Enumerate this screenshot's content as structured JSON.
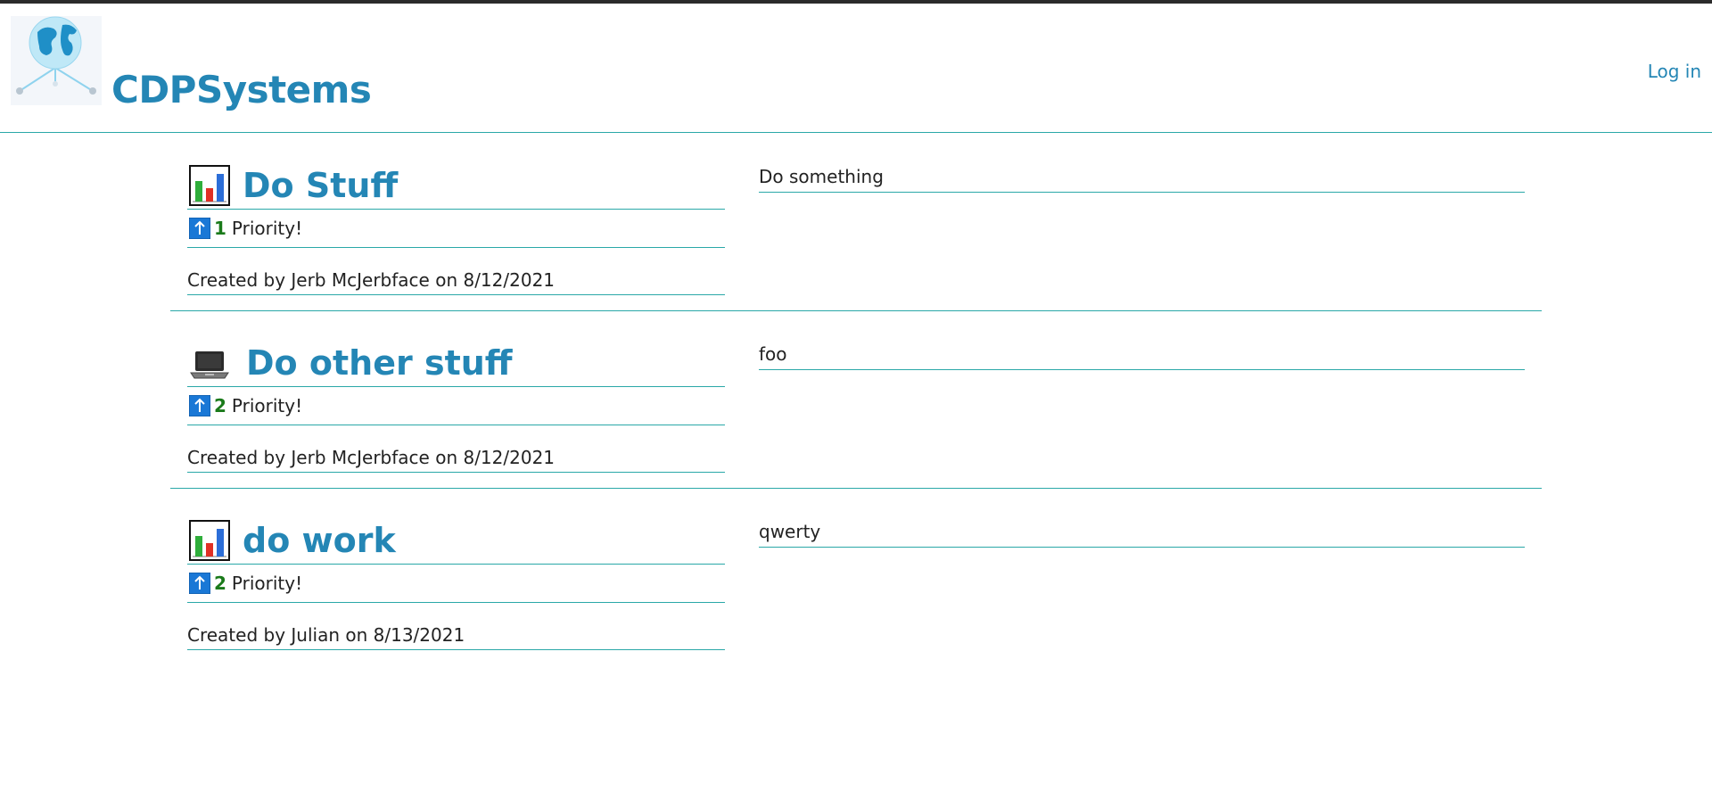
{
  "header": {
    "brand": "CDPSystems",
    "login_label": "Log in"
  },
  "tasks": [
    {
      "icon": "bar-chart-icon",
      "title": "Do Stuff",
      "priority_number": "1",
      "priority_label": "Priority!",
      "created": "Created by Jerb McJerbface on 8/12/2021",
      "description": "Do something"
    },
    {
      "icon": "laptop-icon",
      "title": "Do other stuff",
      "priority_number": "2",
      "priority_label": "Priority!",
      "created": "Created by Jerb McJerbface on 8/12/2021",
      "description": "foo"
    },
    {
      "icon": "bar-chart-icon",
      "title": "do work",
      "priority_number": "2",
      "priority_label": "Priority!",
      "created": "Created by Julian on 8/13/2021",
      "description": "qwerty"
    }
  ],
  "colors": {
    "accent": "#2486b5",
    "divider": "#2aa8a8",
    "priority": "#1a7a1a"
  }
}
